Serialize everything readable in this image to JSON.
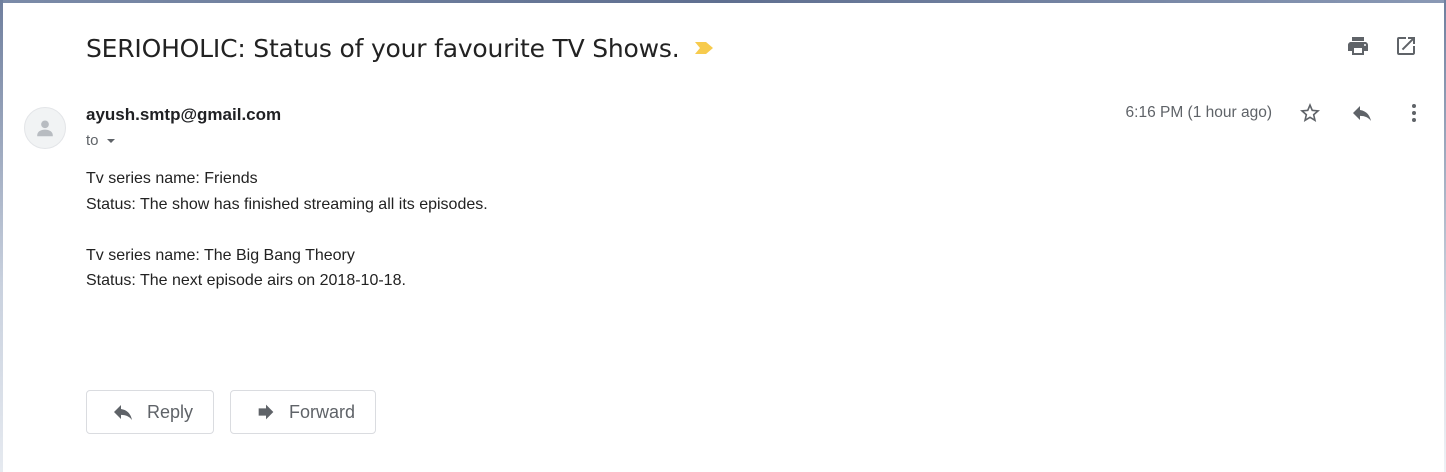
{
  "email": {
    "subject": "SERIOHOLIC: Status of your favourite TV Shows.",
    "label_color": "#f7cb4d",
    "sender_email": "ayush.smtp@gmail.com",
    "to_label": "to",
    "timestamp": "6:16 PM (1 hour ago)",
    "body": [
      {
        "name_line": "Tv series name: Friends",
        "status_line": "Status: The show has finished streaming all its episodes."
      },
      {
        "name_line": "Tv series name: The Big Bang Theory",
        "status_line": "Status: The next episode airs on 2018-10-18."
      }
    ]
  },
  "toolbar": {
    "print_icon": "print-icon",
    "popout_icon": "open-in-new-window-icon",
    "star_icon": "star-icon",
    "reply_icon": "reply-icon",
    "more_icon": "more-vertical-icon"
  },
  "actions": {
    "reply_label": "Reply",
    "forward_label": "Forward"
  }
}
